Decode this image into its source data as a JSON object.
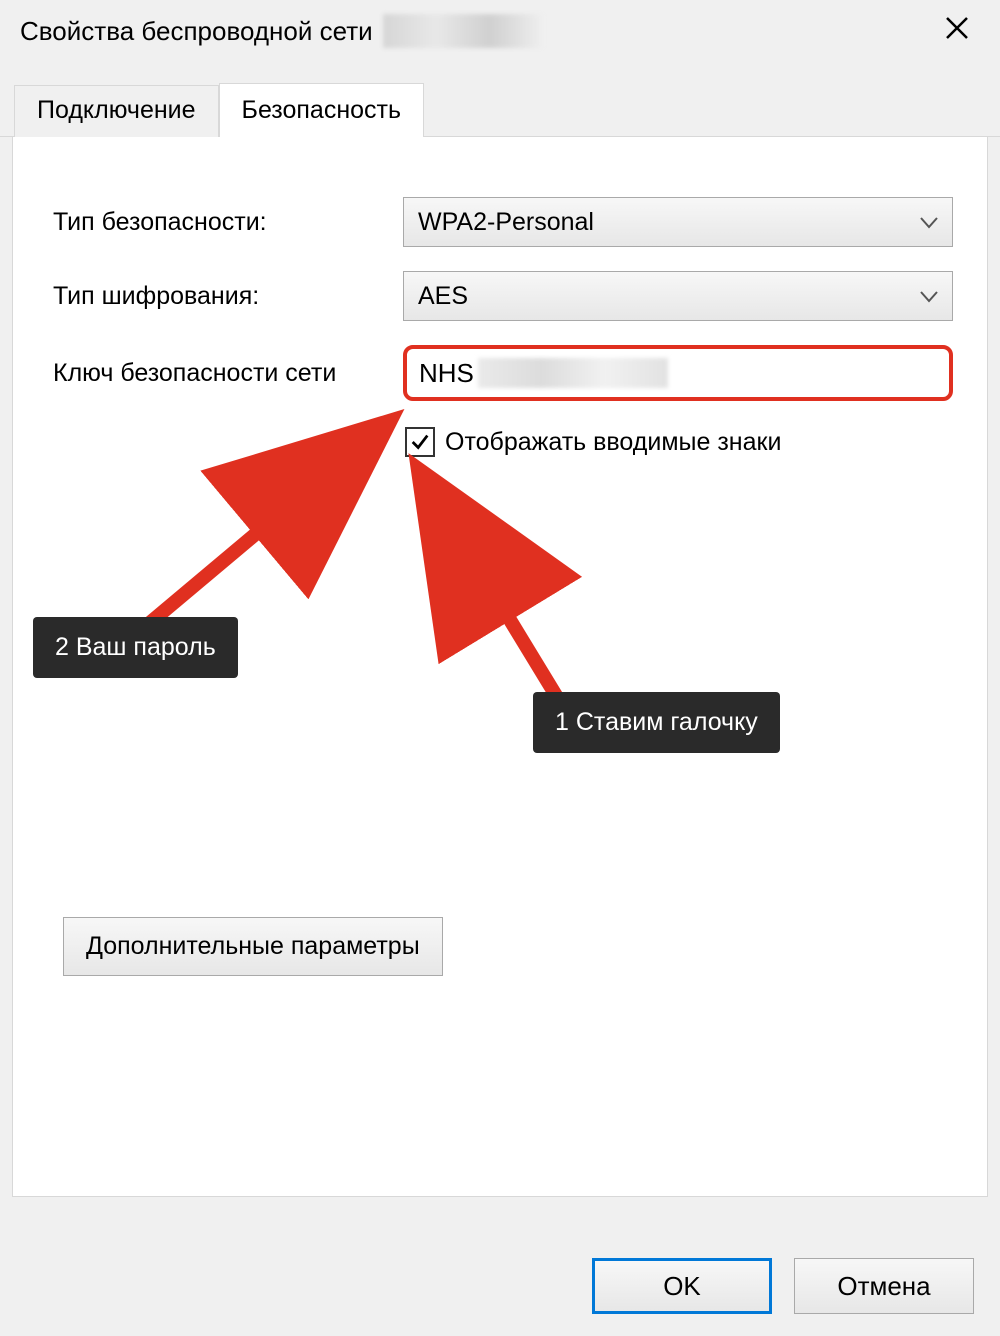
{
  "window": {
    "title": "Свойства беспроводной сети"
  },
  "tabs": {
    "connection": "Подключение",
    "security": "Безопасность"
  },
  "form": {
    "security_type_label": "Тип безопасности:",
    "security_type_value": "WPA2-Personal",
    "encryption_label": "Тип шифрования:",
    "encryption_value": "AES",
    "network_key_label": "Ключ безопасности сети",
    "network_key_value": "NHS",
    "show_chars_label": "Отображать вводимые знаки",
    "advanced_button": "Дополнительные параметры"
  },
  "footer": {
    "ok": "OK",
    "cancel": "Отмена"
  },
  "annotations": {
    "step1": "1 Ставим галочку",
    "step2": "2 Ваш пароль"
  }
}
